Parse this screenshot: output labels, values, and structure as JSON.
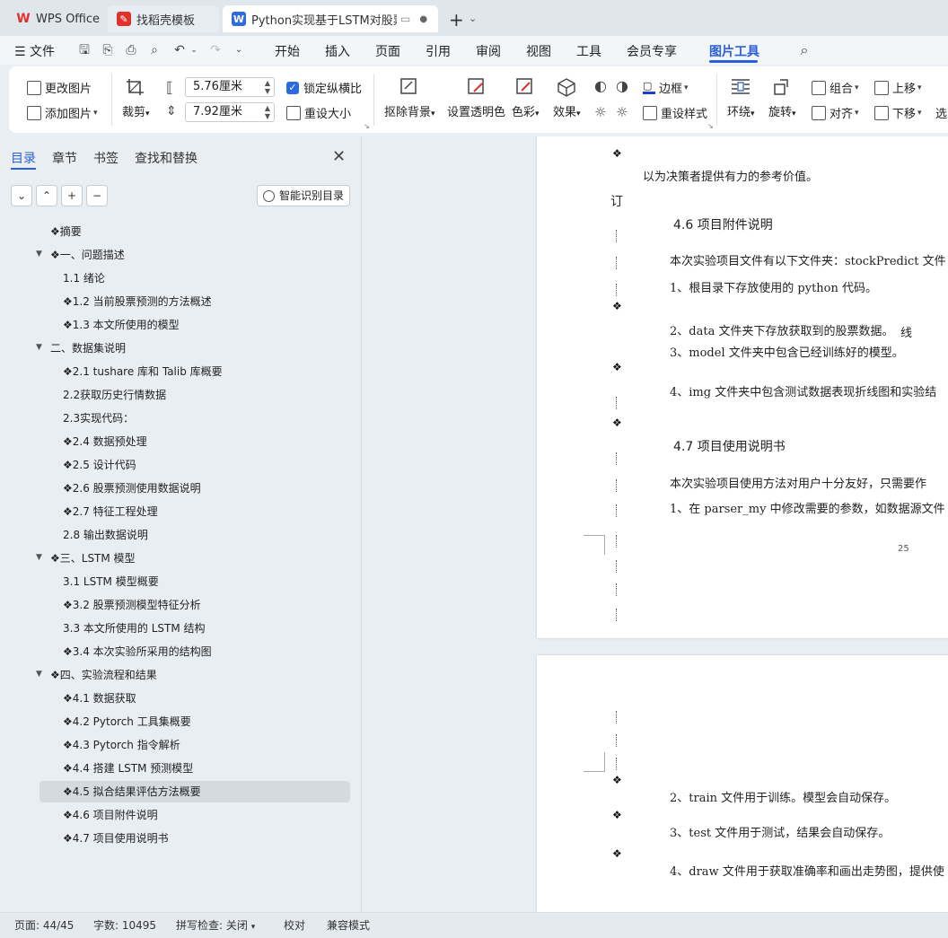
{
  "tabs": {
    "wps": "WPS Office",
    "template": "找稻壳模板",
    "document": "Python实现基于LSTM对股票走",
    "new_tab": "+"
  },
  "menu": {
    "file": "文件",
    "items": [
      "开始",
      "插入",
      "页面",
      "引用",
      "审阅",
      "视图",
      "工具",
      "会员专享",
      "图片工具"
    ],
    "active": "图片工具"
  },
  "ribbon": {
    "change_picture": "更改图片",
    "add_picture": "添加图片",
    "crop": "裁剪",
    "width_value": "5.76厘米",
    "height_value": "7.92厘米",
    "lock_ratio": "锁定纵横比",
    "reset_size": "重设大小",
    "remove_bg": "抠除背景",
    "set_transparent": "设置透明色",
    "color": "色彩",
    "effect": "效果",
    "border": "边框",
    "reset_style": "重设样式",
    "wrap": "环绕",
    "rotate": "旋转",
    "group": "组合",
    "align": "对齐",
    "move_up": "上移",
    "move_down": "下移",
    "select": "选"
  },
  "nav": {
    "tabs": [
      "目录",
      "章节",
      "书签",
      "查找和替换"
    ],
    "smart_toc": "智能识别目录",
    "items": [
      {
        "label": "❖摘要",
        "caret": false
      },
      {
        "label": "❖一、问题描述",
        "caret": true
      },
      {
        "label": "1.1 绪论",
        "caret": false
      },
      {
        "label": "❖1.2 当前股票预测的方法概述",
        "caret": false
      },
      {
        "label": "❖1.3 本文所使用的模型",
        "caret": false
      },
      {
        "label": "二、数据集说明",
        "caret": true
      },
      {
        "label": "❖2.1 tushare 库和 Talib 库概要",
        "caret": false
      },
      {
        "label": "2.2获取历史行情数据",
        "caret": false
      },
      {
        "label": "2.3实现代码：",
        "caret": false
      },
      {
        "label": "❖2.4 数据预处理",
        "caret": false
      },
      {
        "label": "❖2.5 设计代码",
        "caret": false
      },
      {
        "label": "❖2.6 股票预测使用数据说明",
        "caret": false
      },
      {
        "label": "❖2.7 特征工程处理",
        "caret": false
      },
      {
        "label": "2.8 输出数据说明",
        "caret": false
      },
      {
        "label": "❖三、LSTM 模型",
        "caret": true
      },
      {
        "label": "3.1 LSTM 模型概要",
        "caret": false
      },
      {
        "label": "❖3.2 股票预测模型特征分析",
        "caret": false
      },
      {
        "label": "3.3 本文所使用的 LSTM 结构",
        "caret": false
      },
      {
        "label": "❖3.4 本次实验所采用的结构图",
        "caret": false
      },
      {
        "label": "❖四、实验流程和结果",
        "caret": true
      },
      {
        "label": "❖4.1 数据获取",
        "caret": false
      },
      {
        "label": "❖4.2 Pytorch 工具集概要",
        "caret": false
      },
      {
        "label": "❖4.3 Pytorch 指令解析",
        "caret": false
      },
      {
        "label": "❖4.4 搭建 LSTM 预测模型",
        "caret": false
      },
      {
        "label": "❖4.5 拟合结果评估方法概要",
        "caret": false
      },
      {
        "label": "❖4.6 项目附件说明",
        "caret": false
      },
      {
        "label": "❖4.7 项目使用说明书",
        "caret": false
      }
    ],
    "selected_index": 24
  },
  "doc": {
    "page1": {
      "line_value": "以为决策者提供有力的参考价值。",
      "binding_char": "订",
      "h46": "4.6  项目附件说明",
      "p46": "本次实验项目文件有以下文件夹：stockPredict 文件",
      "l1": "1、根目录下存放使用的 python 代码。",
      "l2": "2、data 文件夹下存放获取到的股票数据。",
      "l2_binding": "线",
      "l3": "3、model 文件夹中包含已经训练好的模型。",
      "l4": "4、img 文件夹中包含测试数据表现折线图和实验结",
      "h47": "4.7  项目使用说明书",
      "p47": "本次实验项目使用方法对用户十分友好，只需要作",
      "l47_1": "1、在 parser_my 中修改需要的参数，如数据源文件",
      "page_number": "25"
    },
    "page2": {
      "l2": "2、train 文件用于训练。模型会自动保存。",
      "l3": "3、test 文件用于测试，结果会自动保存。",
      "l4": "4、draw 文件用于获取准确率和画出走势图，提供使"
    }
  },
  "status": {
    "page": "页面: 44/45",
    "words": "字数: 10495",
    "spell": "拼写检查: 关闭",
    "proofread": "校对",
    "compat": "兼容模式"
  },
  "colors": {
    "accent": "#2b5fd9",
    "wps_red": "#e0322b",
    "doc_blue": "#2f6be0"
  }
}
